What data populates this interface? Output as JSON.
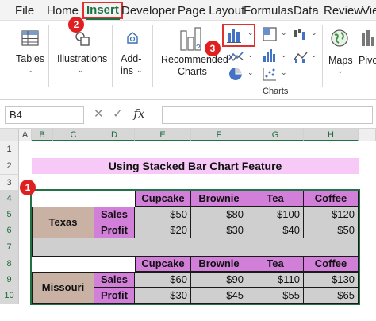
{
  "tabs": [
    "File",
    "Home",
    "Insert",
    "Developer",
    "Page Layout",
    "Formulas",
    "Data",
    "Review",
    "View"
  ],
  "ribbon": {
    "tables_label": "Tables",
    "illustrations_label": "Illustrations",
    "addins_line1": "Add-",
    "addins_line2": "ins",
    "recommended_line1": "Recommended",
    "recommended_line2": "Charts",
    "charts_group_label": "Charts",
    "maps_label": "Maps",
    "pivot_label": "Pivot"
  },
  "callouts": [
    "1",
    "2",
    "3"
  ],
  "formula_bar": {
    "name_box": "B4",
    "fx": "fx"
  },
  "grid": {
    "columns": [
      "A",
      "B",
      "C",
      "D",
      "E",
      "F",
      "G",
      "H"
    ],
    "rows": [
      "1",
      "2",
      "3",
      "4",
      "5",
      "6",
      "7",
      "8",
      "9",
      "10"
    ],
    "title": "Using Stacked Bar Chart Feature",
    "headers": [
      "Cupcake",
      "Brownie",
      "Tea",
      "Coffee"
    ],
    "metrics": [
      "Sales",
      "Profit"
    ],
    "states": [
      "Texas",
      "Missouri"
    ],
    "texas": {
      "sales": [
        "$50",
        "$80",
        "$100",
        "$120"
      ],
      "profit": [
        "$20",
        "$30",
        "$40",
        "$50"
      ]
    },
    "missouri": {
      "sales": [
        "$60",
        "$90",
        "$110",
        "$130"
      ],
      "profit": [
        "$30",
        "$45",
        "$55",
        "$65"
      ]
    }
  },
  "colors": {
    "accent": "#217346",
    "header_fill": "#d17fd8",
    "state_fill": "#c9b1a4",
    "title_fill": "#f6c9f6",
    "callout": "#e02020"
  }
}
